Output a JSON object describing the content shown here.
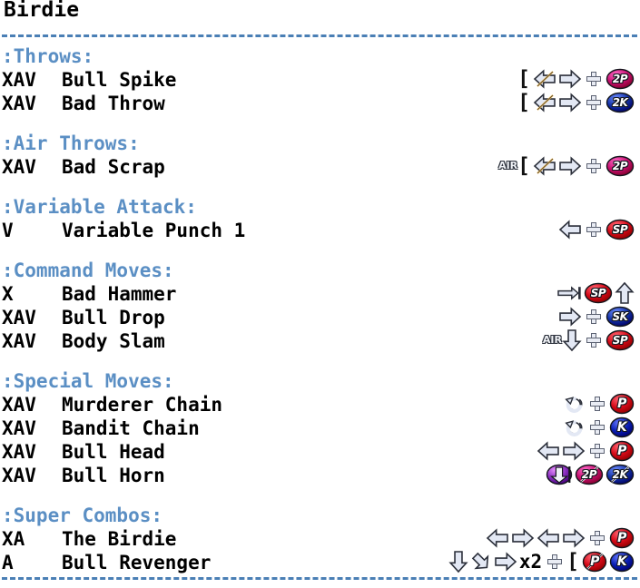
{
  "title": "Birdie",
  "divider": "- - - - - - - - - - - - - - - - - - - - - - - - - - - - - - - - -",
  "colors": {
    "heading": "#5b8fc4",
    "text": "#000000",
    "rule": "#4a7fb5",
    "punch_button": "#d60a18",
    "kick_button": "#0b1fb5",
    "p2_button": "#c81070",
    "k2_button": "#1433a8",
    "sp_button": "#d60a18",
    "sk_button": "#0b1fb5",
    "charge_button": "#8a2fc0",
    "arrow_fill": "#e3e8f4",
    "arrow_outline": "#2b2f3a"
  },
  "sections": [
    {
      "heading": ":Throws:",
      "moves": [
        {
          "tags": "XAV",
          "name": "Bull Spike",
          "inputs": [
            {
              "type": "bracket",
              "label": "["
            },
            {
              "type": "arrow",
              "dir": "left",
              "slash": true,
              "name": "left-arrow-or-right"
            },
            {
              "type": "arrow",
              "dir": "right",
              "slash": false,
              "name": "right-arrow"
            },
            {
              "type": "plus",
              "label": "+"
            },
            {
              "type": "button",
              "label": "2P",
              "color": "#c81070",
              "slash": false
            }
          ]
        },
        {
          "tags": "XAV",
          "name": "Bad Throw",
          "inputs": [
            {
              "type": "bracket",
              "label": "["
            },
            {
              "type": "arrow",
              "dir": "left",
              "slash": true,
              "name": "left-arrow-or-right"
            },
            {
              "type": "arrow",
              "dir": "right",
              "slash": false,
              "name": "right-arrow"
            },
            {
              "type": "plus",
              "label": "+"
            },
            {
              "type": "button",
              "label": "2K",
              "color": "#1433a8",
              "slash": false
            }
          ]
        }
      ]
    },
    {
      "heading": ":Air Throws:",
      "moves": [
        {
          "tags": "XAV",
          "name": "Bad Scrap",
          "inputs": [
            {
              "type": "air",
              "label": "AIR"
            },
            {
              "type": "bracket",
              "label": "["
            },
            {
              "type": "arrow",
              "dir": "left",
              "slash": true,
              "name": "left-arrow-or-right"
            },
            {
              "type": "arrow",
              "dir": "right",
              "slash": false,
              "name": "right-arrow"
            },
            {
              "type": "plus",
              "label": "+"
            },
            {
              "type": "button",
              "label": "2P",
              "color": "#c81070",
              "slash": false
            }
          ]
        }
      ]
    },
    {
      "heading": ":Variable Attack:",
      "moves": [
        {
          "tags": "V",
          "name": "Variable Punch 1",
          "inputs": [
            {
              "type": "arrow",
              "dir": "left",
              "slash": false,
              "name": "left-arrow"
            },
            {
              "type": "plus",
              "label": "+"
            },
            {
              "type": "button",
              "label": "SP",
              "color": "#d60a18",
              "slash": false
            }
          ]
        }
      ]
    },
    {
      "heading": ":Command Moves:",
      "moves": [
        {
          "tags": "X",
          "name": "Bad Hammer",
          "inputs": [
            {
              "type": "arrow",
              "dir": "right-wall",
              "slash": false,
              "name": "dash-into-wall-arrow"
            },
            {
              "type": "button",
              "label": "SP",
              "color": "#d60a18",
              "slash": false
            },
            {
              "type": "arrow",
              "dir": "up",
              "slash": false,
              "name": "up-arrow"
            }
          ]
        },
        {
          "tags": "XAV",
          "name": "Bull Drop",
          "inputs": [
            {
              "type": "arrow",
              "dir": "right",
              "slash": false,
              "name": "right-arrow"
            },
            {
              "type": "plus",
              "label": "+"
            },
            {
              "type": "button",
              "label": "SK",
              "color": "#1433a8",
              "slash": false
            }
          ]
        },
        {
          "tags": "XAV",
          "name": "Body Slam",
          "inputs": [
            {
              "type": "air",
              "label": "AIR"
            },
            {
              "type": "arrow",
              "dir": "down",
              "slash": false,
              "name": "down-arrow"
            },
            {
              "type": "plus",
              "label": "+"
            },
            {
              "type": "button",
              "label": "SP",
              "color": "#d60a18",
              "slash": false
            }
          ]
        }
      ]
    },
    {
      "heading": ":Special Moves:",
      "moves": [
        {
          "tags": "XAV",
          "name": "Murderer Chain",
          "inputs": [
            {
              "type": "arrow",
              "dir": "rotate",
              "slash": false,
              "name": "rotation-360-arrow"
            },
            {
              "type": "plus",
              "label": "+"
            },
            {
              "type": "button",
              "label": "P",
              "color": "#d60a18",
              "slash": false
            }
          ]
        },
        {
          "tags": "XAV",
          "name": "Bandit Chain",
          "inputs": [
            {
              "type": "arrow",
              "dir": "rotate",
              "slash": false,
              "name": "rotation-360-arrow"
            },
            {
              "type": "plus",
              "label": "+"
            },
            {
              "type": "button",
              "label": "K",
              "color": "#0b1fb5",
              "slash": false
            }
          ]
        },
        {
          "tags": "XAV",
          "name": "Bull Head",
          "inputs": [
            {
              "type": "arrow",
              "dir": "left",
              "slash": false,
              "name": "left-arrow"
            },
            {
              "type": "arrow",
              "dir": "right",
              "slash": false,
              "name": "right-arrow"
            },
            {
              "type": "plus",
              "label": "+"
            },
            {
              "type": "button",
              "label": "P",
              "color": "#d60a18",
              "slash": false
            }
          ]
        },
        {
          "tags": "XAV",
          "name": "Bull Horn",
          "inputs": [
            {
              "type": "holdbutton",
              "label": "",
              "color": "#8a2fc0",
              "name": "charge-down-button"
            },
            {
              "type": "button",
              "label": "2P",
              "color": "#c81070",
              "slash": true
            },
            {
              "type": "button",
              "label": "2K",
              "color": "#1433a8",
              "slash": true
            }
          ]
        }
      ]
    },
    {
      "heading": ":Super Combos:",
      "moves": [
        {
          "tags": "XA",
          "name": "The Birdie",
          "inputs": [
            {
              "type": "arrow",
              "dir": "left",
              "slash": false,
              "name": "left-arrow"
            },
            {
              "type": "arrow",
              "dir": "right",
              "slash": false,
              "name": "right-arrow"
            },
            {
              "type": "arrow",
              "dir": "left",
              "slash": false,
              "name": "left-arrow"
            },
            {
              "type": "arrow",
              "dir": "right",
              "slash": false,
              "name": "right-arrow"
            },
            {
              "type": "plus",
              "label": "+"
            },
            {
              "type": "button",
              "label": "P",
              "color": "#d60a18",
              "slash": false
            }
          ]
        },
        {
          "tags": "A",
          "name": "Bull Revenger",
          "inputs": [
            {
              "type": "arrow",
              "dir": "down",
              "slash": false,
              "name": "down-arrow"
            },
            {
              "type": "arrow",
              "dir": "down-right",
              "slash": false,
              "name": "down-right-arrow"
            },
            {
              "type": "arrow",
              "dir": "right",
              "slash": false,
              "name": "right-arrow"
            },
            {
              "type": "repeat",
              "label": "x2"
            },
            {
              "type": "plus",
              "label": "+"
            },
            {
              "type": "bracket",
              "label": "["
            },
            {
              "type": "button",
              "label": "P",
              "color": "#d60a18",
              "slash": true
            },
            {
              "type": "button",
              "label": "K",
              "color": "#0b1fb5",
              "slash": false
            }
          ]
        }
      ]
    }
  ]
}
